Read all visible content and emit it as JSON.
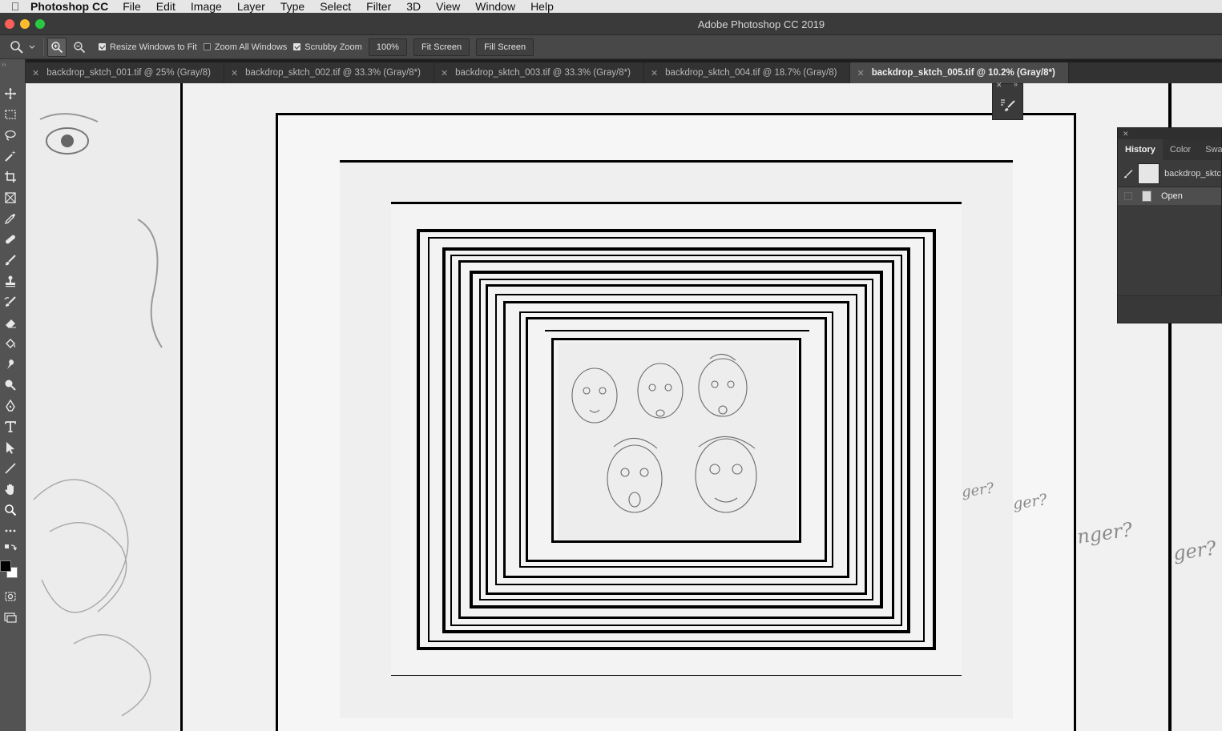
{
  "menubar": {
    "app_name": "Photoshop CC",
    "items": [
      "File",
      "Edit",
      "Image",
      "Layer",
      "Type",
      "Select",
      "Filter",
      "3D",
      "View",
      "Window",
      "Help"
    ]
  },
  "window": {
    "title": "Adobe Photoshop CC 2019"
  },
  "options": {
    "resize_windows": "Resize Windows to Fit",
    "resize_windows_checked": true,
    "zoom_all_windows": "Zoom All Windows",
    "zoom_all_windows_checked": false,
    "scrubby_zoom": "Scrubby Zoom",
    "scrubby_zoom_checked": true,
    "zoom_percent": "100%",
    "fit_screen": "Fit Screen",
    "fill_screen": "Fill Screen"
  },
  "tabs": [
    {
      "label": "backdrop_sktch_001.tif @ 25% (Gray/8)",
      "active": false
    },
    {
      "label": "backdrop_sktch_002.tif @ 33.3% (Gray/8*)",
      "active": false
    },
    {
      "label": "backdrop_sktch_003.tif @ 33.3% (Gray/8*)",
      "active": false
    },
    {
      "label": "backdrop_sktch_004.tif @ 18.7% (Gray/8)",
      "active": false
    },
    {
      "label": "backdrop_sktch_005.tif @ 10.2% (Gray/8*)",
      "active": true
    }
  ],
  "history_panel": {
    "tabs": [
      "History",
      "Color",
      "Swa"
    ],
    "active_tab": "History",
    "snapshot_label": "backdrop_sktc",
    "items": [
      "Open"
    ]
  },
  "canvas_text": {
    "scribble_1": "ger?",
    "scribble_2": "ger?",
    "scribble_3": "nger?",
    "scribble_4": "ger?"
  }
}
